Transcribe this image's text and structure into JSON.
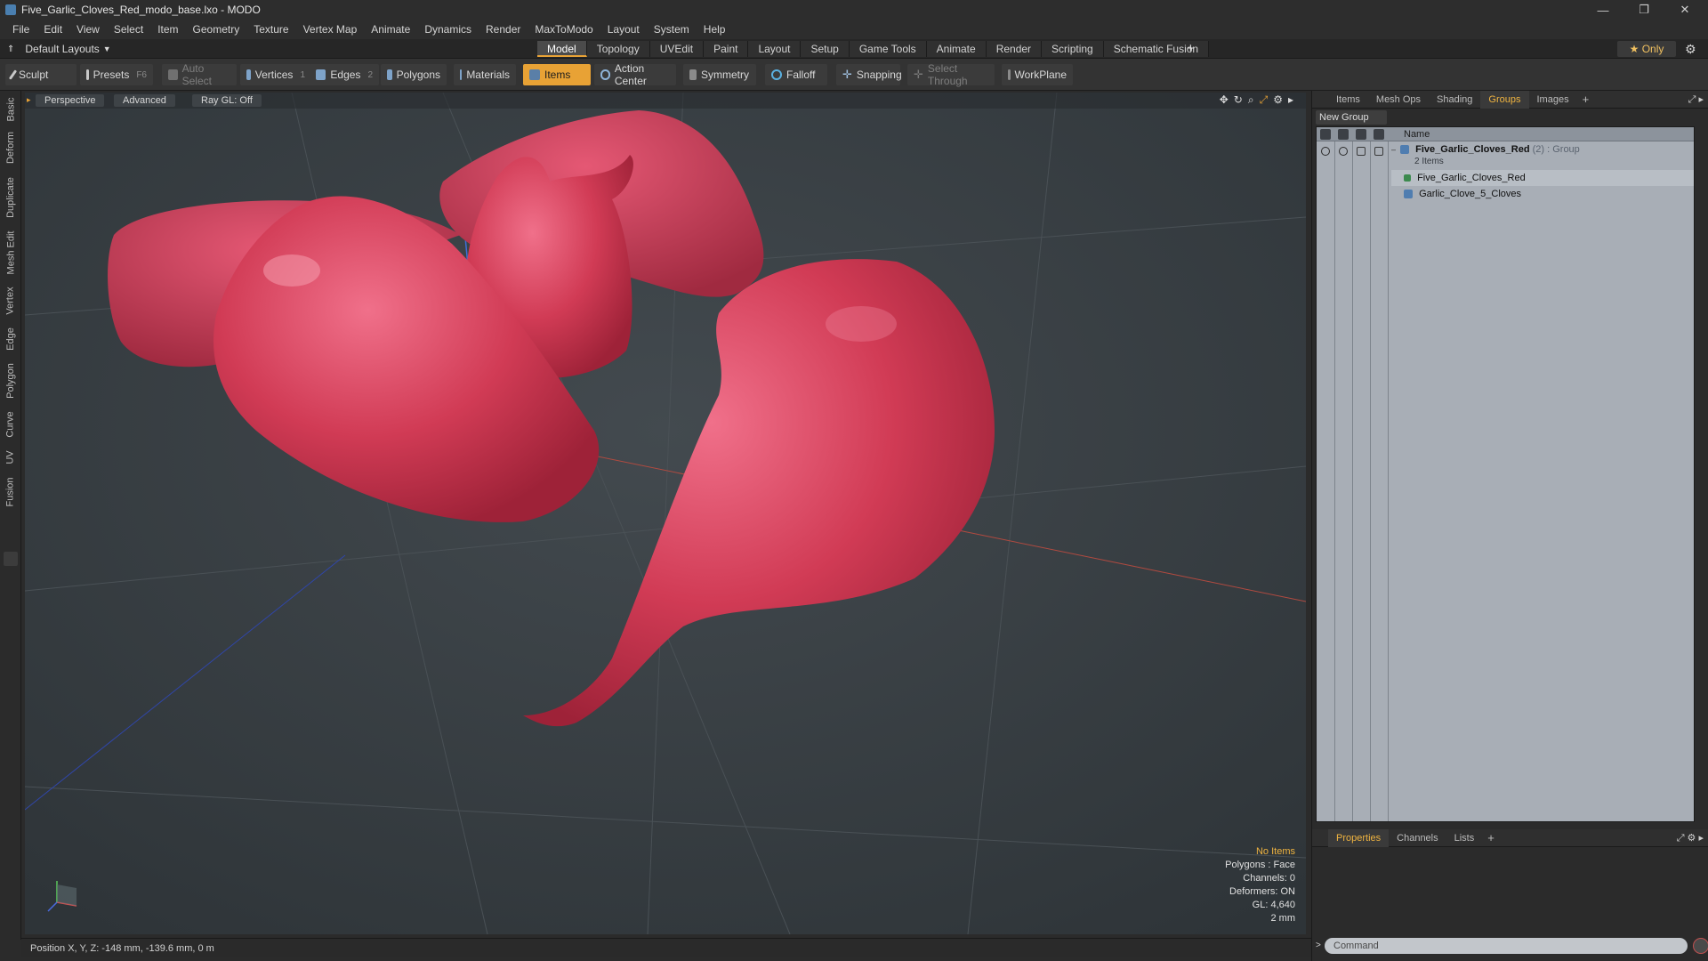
{
  "window": {
    "title": "Five_Garlic_Cloves_Red_modo_base.lxo - MODO",
    "controls": [
      "minimize-icon",
      "restore-icon",
      "close-icon"
    ]
  },
  "menu": [
    "File",
    "Edit",
    "View",
    "Select",
    "Item",
    "Geometry",
    "Texture",
    "Vertex Map",
    "Animate",
    "Dynamics",
    "Render",
    "MaxToModo",
    "Layout",
    "System",
    "Help"
  ],
  "layout_selector": "Default Layouts",
  "mode_tabs": [
    "Model",
    "Topology",
    "UVEdit",
    "Paint",
    "Layout",
    "Setup",
    "Game Tools",
    "Animate",
    "Render",
    "Scripting",
    "Schematic Fusion"
  ],
  "active_mode_tab": "Model",
  "only_button": "★ Only",
  "toolbar": {
    "sculpt": "Sculpt",
    "presets": "Presets",
    "presets_key": "F6",
    "auto_select": "Auto Select",
    "vertices": "Vertices",
    "vertices_count": "1",
    "edges": "Edges",
    "edges_count": "2",
    "polygons": "Polygons",
    "materials": "Materials",
    "items": "Items",
    "action_center": "Action Center",
    "symmetry": "Symmetry",
    "falloff": "Falloff",
    "snapping": "Snapping",
    "select_through": "Select Through",
    "workplane": "WorkPlane"
  },
  "left_tabs": [
    "Basic",
    "Deform",
    "Duplicate",
    "Mesh Edit",
    "Vertex",
    "Edge",
    "Polygon",
    "Curve",
    "UV",
    "Fusion"
  ],
  "viewport": {
    "view": "Perspective",
    "style": "Advanced",
    "raygl": "Ray GL: Off",
    "info": {
      "items": "No Items",
      "polygons": "Polygons : Face",
      "channels": "Channels: 0",
      "deformers": "Deformers: ON",
      "gl": "GL: 4,640",
      "scale": "2 mm"
    },
    "mesh_color": "#d13b55"
  },
  "status": "Position X, Y, Z:  -148 mm, -139.6 mm, 0 m",
  "right_panel": {
    "tabs": [
      "Items",
      "Mesh Ops",
      "Shading",
      "Groups",
      "Images"
    ],
    "active_tab": "Groups",
    "new_group": "New Group",
    "name_header": "Name",
    "group": {
      "name": "Five_Garlic_Cloves_Red",
      "suffix": "(2) : Group",
      "count": "2 Items"
    },
    "children": [
      "Five_Garlic_Cloves_Red",
      "Garlic_Clove_5_Cloves"
    ],
    "bottom_tabs": [
      "Properties",
      "Channels",
      "Lists"
    ],
    "bottom_active_tab": "Properties",
    "command_placeholder": "Command"
  }
}
